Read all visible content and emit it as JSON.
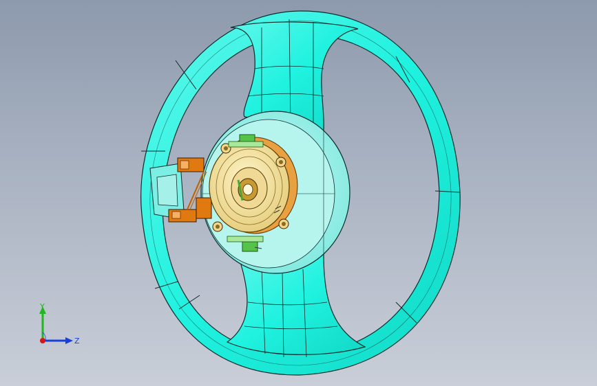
{
  "viewport": {
    "background_top": "#8d9aad",
    "background_bottom": "#c9ced8"
  },
  "model": {
    "name": "steering-wheel",
    "rim_color": "#1ff2df",
    "hub_color": "#a5f1ea",
    "clockspring_color": "#f2e2a0",
    "housing_color": "#e8a040",
    "connector_color": "#e07a10",
    "edge_color": "#0a2a2a"
  },
  "triad": {
    "y_label": "Y",
    "z_label": "Z",
    "y_color": "#1fb81f",
    "z_color": "#1a3fd6",
    "x_color": "#d01818"
  }
}
